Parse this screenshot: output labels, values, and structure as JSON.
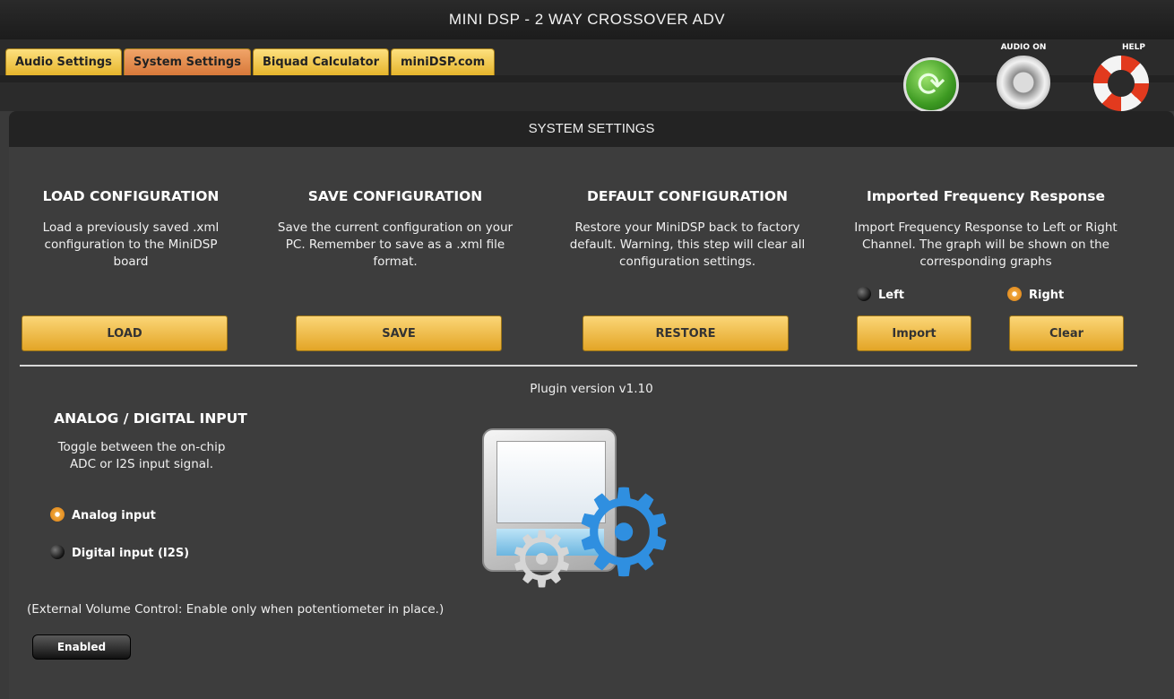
{
  "title": "MINI DSP - 2 WAY CROSSOVER ADV",
  "tabs": [
    {
      "label": "Audio Settings"
    },
    {
      "label": "System Settings"
    },
    {
      "label": "Biquad Calculator"
    },
    {
      "label": "miniDSP.com"
    }
  ],
  "toolbar": {
    "refresh_icon": "refresh-icon",
    "audio_label": "AUDIO ON",
    "audio_icon": "speaker-icon",
    "help_label": "HELP",
    "help_icon": "lifebuoy-icon"
  },
  "panel_title": "SYSTEM SETTINGS",
  "load": {
    "heading": "LOAD CONFIGURATION",
    "description": "Load a previously saved .xml configuration to the MiniDSP board",
    "button": "LOAD"
  },
  "save": {
    "heading": "SAVE CONFIGURATION",
    "description": "Save the current configuration on your PC. Remember to save as a .xml file format.",
    "button": "SAVE"
  },
  "default": {
    "heading": "DEFAULT CONFIGURATION",
    "description": "Restore your MiniDSP back to factory default. Warning, this step will clear all configuration settings.",
    "button": "RESTORE"
  },
  "import": {
    "heading": "Imported Frequency Response",
    "description": "Import Frequency Response to Left or Right Channel. The graph will be shown on the corresponding graphs",
    "left_label": "Left",
    "right_label": "Right",
    "selected": "Right",
    "import_button": "Import",
    "clear_button": "Clear"
  },
  "plugin_version": "Plugin version v1.10",
  "input": {
    "heading": "ANALOG / DIGITAL INPUT",
    "description": "Toggle between the on-chip ADC or I2S input signal.",
    "analog_label": "Analog input",
    "digital_label": "Digital input (I2S)",
    "selected": "Analog input"
  },
  "volume": {
    "note": "(External Volume Control: Enable only when potentiometer in place.)",
    "button": "Enabled"
  },
  "colors": {
    "accent": "#e8b33a",
    "active_tab": "#d8793a",
    "background": "#3d3d3d"
  }
}
